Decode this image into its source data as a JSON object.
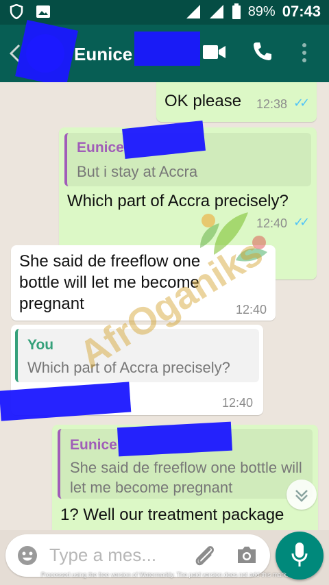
{
  "status_bar": {
    "battery_percent": "89%",
    "time": "07:43",
    "icons": [
      "shield-icon",
      "image-icon",
      "signal-icon",
      "signal-icon",
      "battery-icon"
    ]
  },
  "app_bar": {
    "contact_name": "Eunice",
    "icons": [
      "back-icon",
      "video-call-icon",
      "phone-call-icon",
      "more-vertical-icon"
    ]
  },
  "messages": [
    {
      "direction": "outgoing",
      "text": "OK please",
      "time": "12:38",
      "read": true
    },
    {
      "direction": "outgoing",
      "quote": {
        "name": "Eunice",
        "text": "But i stay at Accra"
      },
      "text": "Which part of Accra precisely?",
      "time": "12:40",
      "read": true
    },
    {
      "direction": "incoming",
      "text": "She said de freeflow  one bottle will let me become pregnant",
      "time": "12:40"
    },
    {
      "direction": "incoming",
      "quote": {
        "name": "You",
        "text": "Which part of Accra precisely?"
      },
      "text": "",
      "time": "12:40"
    },
    {
      "direction": "outgoing",
      "quote": {
        "name": "Eunice",
        "text": "She said de freeflow  one bottle will let me become pregnant"
      },
      "text": "1? Well our treatment package"
    }
  ],
  "watermark": {
    "brand": "AfrOganiks"
  },
  "input_bar": {
    "placeholder": "Type a mes..."
  },
  "footer_note": "Processed using the free version of Watermarkly. The paid version does not add this mark.",
  "colors": {
    "header": "#075e54",
    "status_bar": "#054d44",
    "outgoing": "#dcf8c6",
    "incoming": "#ffffff",
    "accent": "#00897b",
    "read_ticks": "#4fc3f7"
  }
}
